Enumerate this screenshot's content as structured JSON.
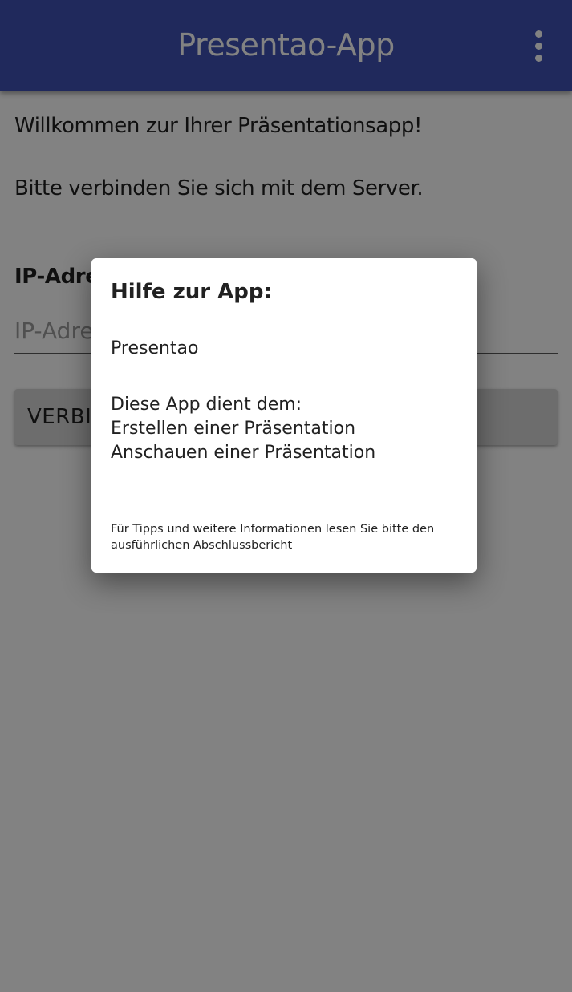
{
  "app_bar": {
    "title": "Presentao-App",
    "menu_icon": "overflow-menu-icon"
  },
  "main": {
    "welcome": "Willkommen zur Ihrer Präsentationsapp!",
    "connect_hint": "Bitte verbinden Sie sich mit dem Server.",
    "ip_label": "IP-Adresse:",
    "ip_placeholder": "IP-Adresse",
    "connect_button": "VERBINDEN"
  },
  "dialog": {
    "title": "Hilfe zur App:",
    "app_name": "Presentao",
    "purpose_heading": "Diese App dient dem:",
    "purpose_items": [
      "Erstellen einer Präsentation",
      "Anschauen einer Präsentation"
    ],
    "note": "Für Tipps und weitere Informationen lesen Sie bitte den ausführlichen Abschlussbericht"
  },
  "colors": {
    "app_bar": "#3f51b5",
    "scrim": "rgba(0,0,0,0.49)",
    "button": "#d6d6d6"
  }
}
